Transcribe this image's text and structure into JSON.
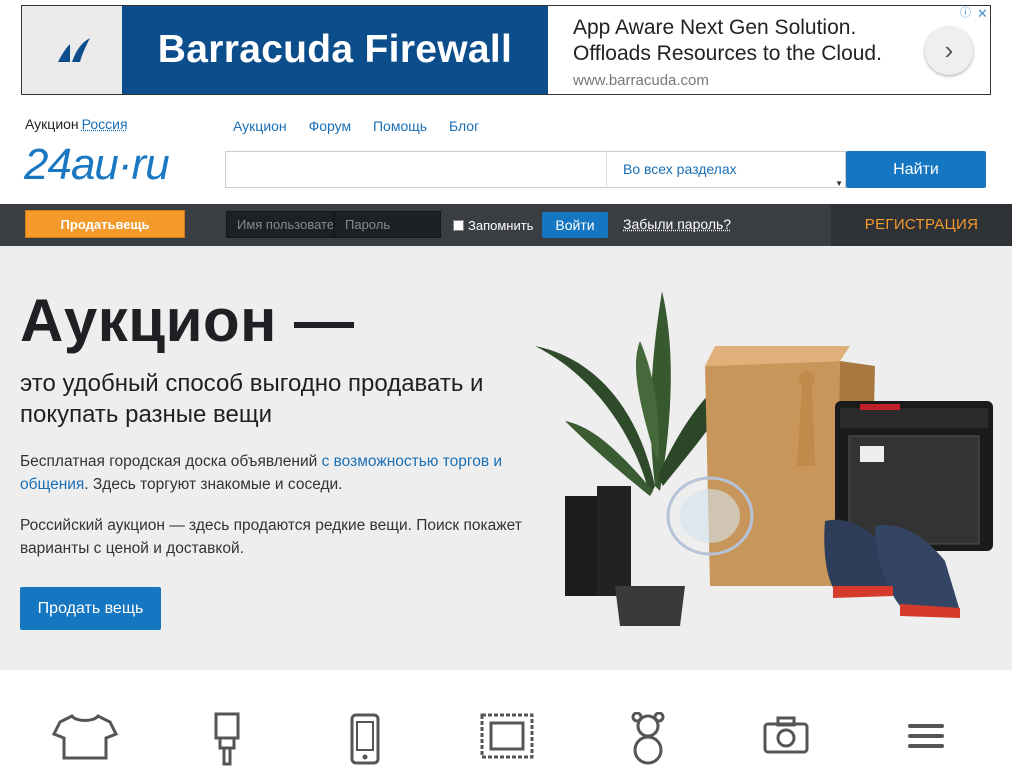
{
  "ad": {
    "brand": "Barracuda Firewall",
    "line1": "App Aware Next Gen Solution.",
    "line2": "Offloads Resources to the Cloud.",
    "url": "www.barracuda.com",
    "next_icon": "chevron-right-icon",
    "info_icon": "info-icon",
    "close_icon": "close-icon",
    "brand_color": "#0c4d8c"
  },
  "header": {
    "region_label": "Аукцион",
    "region_link": "Россия",
    "logo": "24au·ru",
    "nav": [
      "Аукцион",
      "Форум",
      "Помощь",
      "Блог"
    ],
    "search": {
      "value": "",
      "category": "Во всех разделах",
      "button": "Найти"
    }
  },
  "bar": {
    "sell": "Продатьвещь",
    "username_placeholder": "Имя пользователя",
    "password_placeholder": "Пароль",
    "remember": "Запомнить",
    "login": "Войти",
    "forgot": "Забыли пароль?",
    "register": "РЕГИСТРАЦИЯ"
  },
  "hero": {
    "title": "Аукцион —",
    "subtitle": "это удобный способ выгодно продавать и покупать разные вещи",
    "p1_text": "Бесплатная городская доска объявлений ",
    "p1_link": "с возможностью торгов и общения",
    "p1_tail": ". Здесь торгуют знакомые и соседи.",
    "p2": "Российский аукцион — здесь продаются редкие вещи. Поиск покажет варианты с ценой и доставкой.",
    "button": "Продать вещь"
  },
  "categories": [
    "tshirt-icon",
    "paintbrush-icon",
    "phone-icon",
    "stamp-icon",
    "teddy-bear-icon",
    "camera-icon",
    "menu-icon"
  ],
  "colors": {
    "accent_blue": "#1576c1",
    "orange": "#f39a2b",
    "dark_bar": "#3a3d42",
    "link": "#1a6fb5"
  }
}
